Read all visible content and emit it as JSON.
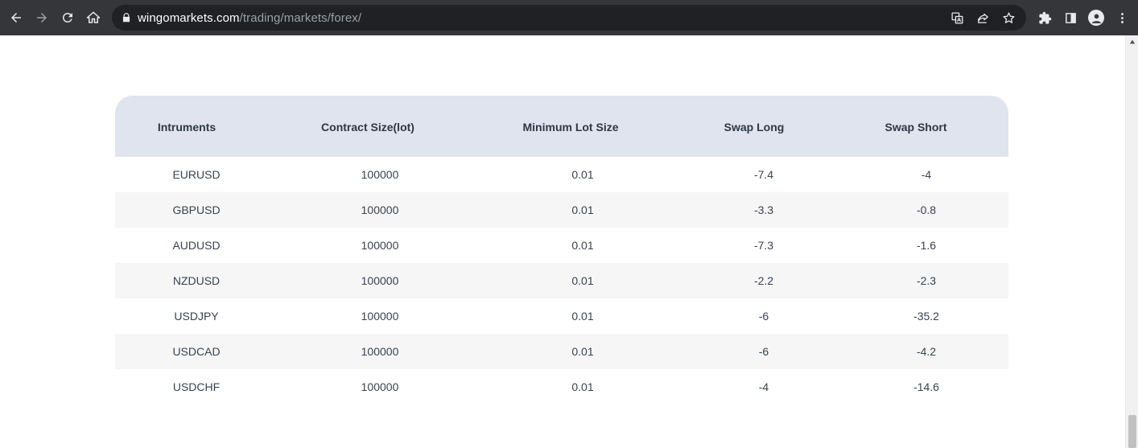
{
  "browser": {
    "url_host": "wingomarkets.com",
    "url_path": "/trading/markets/forex/",
    "icons": [
      "back-icon",
      "forward-icon",
      "reload-icon",
      "home-icon",
      "lock-icon",
      "translate-icon",
      "share-icon",
      "star-icon",
      "extensions-icon",
      "sidepanel-icon",
      "profile-icon",
      "menu-icon"
    ]
  },
  "table": {
    "headers": [
      "Intruments",
      "Contract Size(lot)",
      "Minimum Lot Size",
      "Swap Long",
      "Swap Short"
    ],
    "rows": [
      [
        "EURUSD",
        "100000",
        "0.01",
        "-7.4",
        "-4"
      ],
      [
        "GBPUSD",
        "100000",
        "0.01",
        "-3.3",
        "-0.8"
      ],
      [
        "AUDUSD",
        "100000",
        "0.01",
        "-7.3",
        "-1.6"
      ],
      [
        "NZDUSD",
        "100000",
        "0.01",
        "-2.2",
        "-2.3"
      ],
      [
        "USDJPY",
        "100000",
        "0.01",
        "-6",
        "-35.2"
      ],
      [
        "USDCAD",
        "100000",
        "0.01",
        "-6",
        "-4.2"
      ],
      [
        "USDCHF",
        "100000",
        "0.01",
        "-4",
        "-14.6"
      ]
    ]
  },
  "colors": {
    "toolbar": "#35363a",
    "omnibox": "#202124",
    "header_bg": "#dfe4ef",
    "alt_row_bg": "#f6f6f6"
  }
}
